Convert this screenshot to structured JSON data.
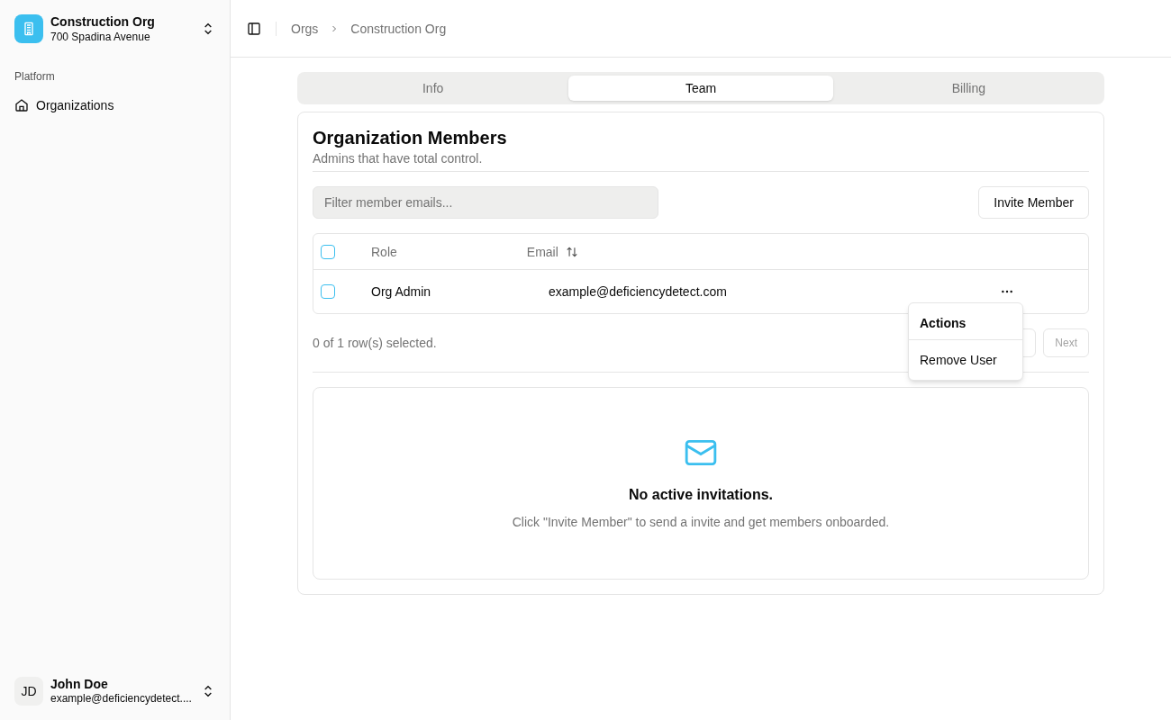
{
  "org": {
    "name": "Construction Org",
    "address": "700 Spadina Avenue"
  },
  "sidebar": {
    "group_label": "Platform",
    "items": [
      {
        "label": "Organizations",
        "selected": false
      }
    ]
  },
  "user": {
    "initials": "JD",
    "name": "John Doe",
    "email": "example@deficiencydetect...."
  },
  "breadcrumbs": [
    "Orgs",
    "Construction Org"
  ],
  "tabs": [
    {
      "label": "Info",
      "selected": false
    },
    {
      "label": "Team",
      "selected": true
    },
    {
      "label": "Billing",
      "selected": false
    }
  ],
  "members": {
    "title": "Organization Members",
    "subtitle": "Admins that have total control.",
    "filter": {
      "placeholder": "Filter member emails..."
    },
    "invite_button": "Invite Member",
    "table": {
      "columns": [
        "Role",
        "Email"
      ],
      "rows": [
        {
          "checked": false,
          "role": "Org Admin",
          "email": "example@deficiencydetect.com"
        }
      ],
      "header_checked": false
    },
    "selection_text": "0 of 1 row(s) selected.",
    "next_button": "Next",
    "menu": {
      "title": "Actions",
      "items": [
        "Remove User"
      ]
    }
  },
  "invitations": {
    "title": "No active invitations.",
    "text": "Click \"Invite Member\" to send a invite and get members onboarded."
  }
}
